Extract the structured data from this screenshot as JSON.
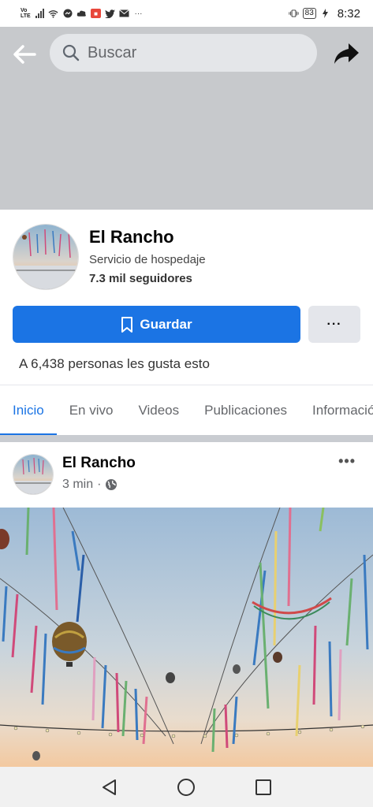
{
  "status_bar": {
    "network": "Vo LTE",
    "battery": "83",
    "time": "8:32"
  },
  "header": {
    "search_placeholder": "Buscar"
  },
  "page": {
    "name": "El Rancho",
    "category": "Servicio de hospedaje",
    "followers": "7.3 mil seguidores",
    "save_label": "Guardar",
    "more_label": "···",
    "likes_text": "A 6,438 personas les gusta esto"
  },
  "tabs": [
    {
      "label": "Inicio"
    },
    {
      "label": "En vivo"
    },
    {
      "label": "Videos"
    },
    {
      "label": "Publicaciones"
    },
    {
      "label": "Información"
    }
  ],
  "post": {
    "author": "El Rancho",
    "time": "3 min",
    "separator": "·",
    "menu": "•••"
  },
  "icons": {
    "back": "back-arrow-icon",
    "search": "search-icon",
    "share": "share-icon",
    "bookmark": "bookmark-icon",
    "globe": "globe-icon",
    "nav_back": "nav-back-icon",
    "nav_home": "nav-home-icon",
    "nav_recents": "nav-recents-icon"
  },
  "colors": {
    "accent": "#1b74e4",
    "cover": "#c7c9cc"
  }
}
